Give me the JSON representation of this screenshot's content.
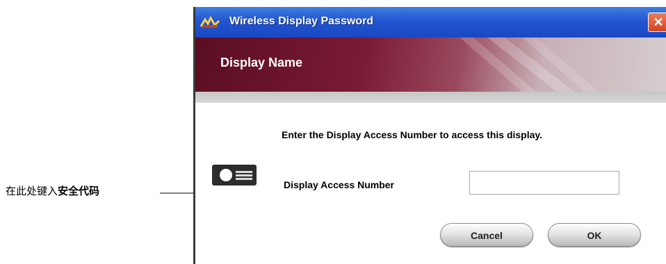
{
  "window": {
    "title": "Wireless Display Password",
    "close_glyph": "✕"
  },
  "banner": {
    "title": "Display Name"
  },
  "dialog": {
    "instructions": "Enter the Display Access Number to access this display.",
    "field_label": "Display Access Number",
    "access_number_value": "",
    "access_number_placeholder": ""
  },
  "buttons": {
    "cancel_label": "Cancel",
    "ok_label": "OK"
  },
  "callout": {
    "text_normal": "在此处键入",
    "text_bold": "安全代码"
  },
  "icons": {
    "title_icon": "wireless-display-icon",
    "projector": "projector-icon"
  },
  "colors": {
    "titlebar": "#2355cf",
    "banner": "#6a1430",
    "close_button": "#d6441d"
  }
}
